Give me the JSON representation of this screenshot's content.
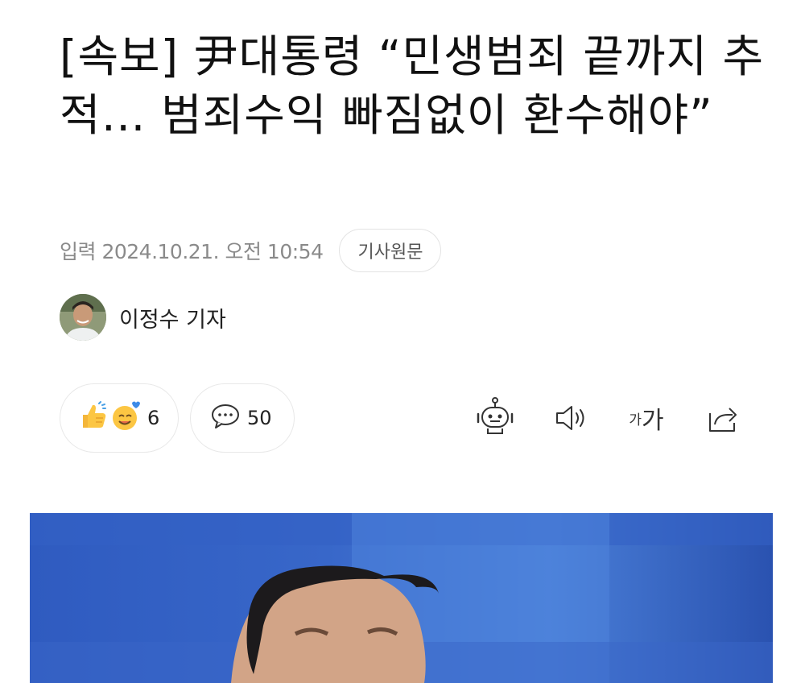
{
  "article": {
    "headline": "[속보] 尹대통령 “민생범죄 끝까지 추적… 범죄수익 빠짐없이 환수해야”",
    "published": "입력 2024.10.21. 오전 10:54",
    "original_button": "기사원문",
    "reporter": "이정수 기자"
  },
  "reactions": {
    "count": "6",
    "icons": [
      "thumbs-up-icon",
      "smiling-face-icon"
    ]
  },
  "comments": {
    "count": "50",
    "icon": "speech-bubble-icon"
  },
  "toolbar": {
    "icons": [
      "robot-summary-icon",
      "speaker-icon",
      "font-size-icon",
      "share-icon"
    ],
    "font_size_small": "가",
    "font_size_large": "가"
  },
  "colors": {
    "text": "#111111",
    "meta": "#8a8a8a",
    "border": "#e3e3e3",
    "photo_background": "#2a4fa8"
  }
}
